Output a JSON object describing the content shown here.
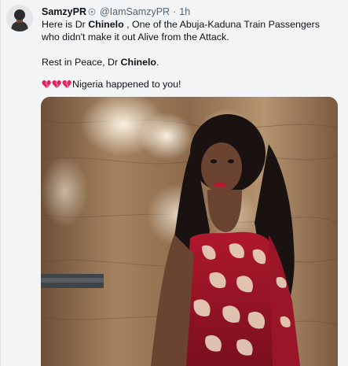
{
  "tweet": {
    "display_name": "SamzyPR",
    "handle": "@IamSamzyPR",
    "separator": "·",
    "time": "1h",
    "line1_prefix": "Here is Dr ",
    "line1_name": "Chinelo",
    "line1_suffix": " , One of the Abuja-Kaduna Train Passengers who didn't make it out Alive from the Attack.",
    "line2_prefix": "Rest in Peace, Dr ",
    "line2_name": "Chinelo",
    "line2_suffix": ".",
    "line3_text": "Nigeria happened to you!",
    "emoji": [
      "broken-heart-icon",
      "broken-heart-icon",
      "broken-heart-icon"
    ]
  },
  "colors": {
    "accent_red": "#e0245e",
    "muted": "#536471",
    "text": "#0f1419"
  }
}
